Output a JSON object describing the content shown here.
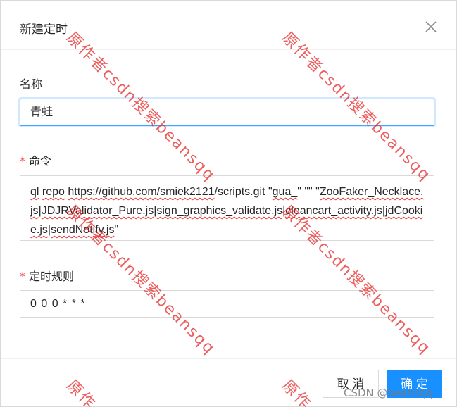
{
  "modal": {
    "title": "新建定时"
  },
  "form": {
    "name": {
      "label": "名称",
      "value": "青蛙"
    },
    "command": {
      "required_mark": "*",
      "label": "命令",
      "parts": [
        "ql",
        " ",
        "repo",
        " ",
        "https://github.com/smiek2121",
        "/scripts.git \"",
        "gua_",
        "\" \"\" \"",
        "ZooFaker_Necklace.js",
        "|",
        "JDJRValidator_Pure.js",
        "|",
        "sign_graphics_validate.js",
        "|",
        "cleancart_activity.js",
        "|",
        "jdCookie.js",
        "|",
        "sendNotify.js",
        "\""
      ]
    },
    "schedule": {
      "required_mark": "*",
      "label": "定时规则",
      "value": "0 0 0 * * *"
    }
  },
  "footer": {
    "cancel_label": "取 消",
    "ok_label": "确 定"
  },
  "watermark": {
    "text": "原作者csdn搜索beansqq",
    "partial_text": "原作"
  },
  "credit": "CSDN @beansqq",
  "colors": {
    "primary": "#1890ff",
    "required": "#ff4d4f",
    "focus_border": "#40a9ff",
    "watermark": "#e62828"
  }
}
